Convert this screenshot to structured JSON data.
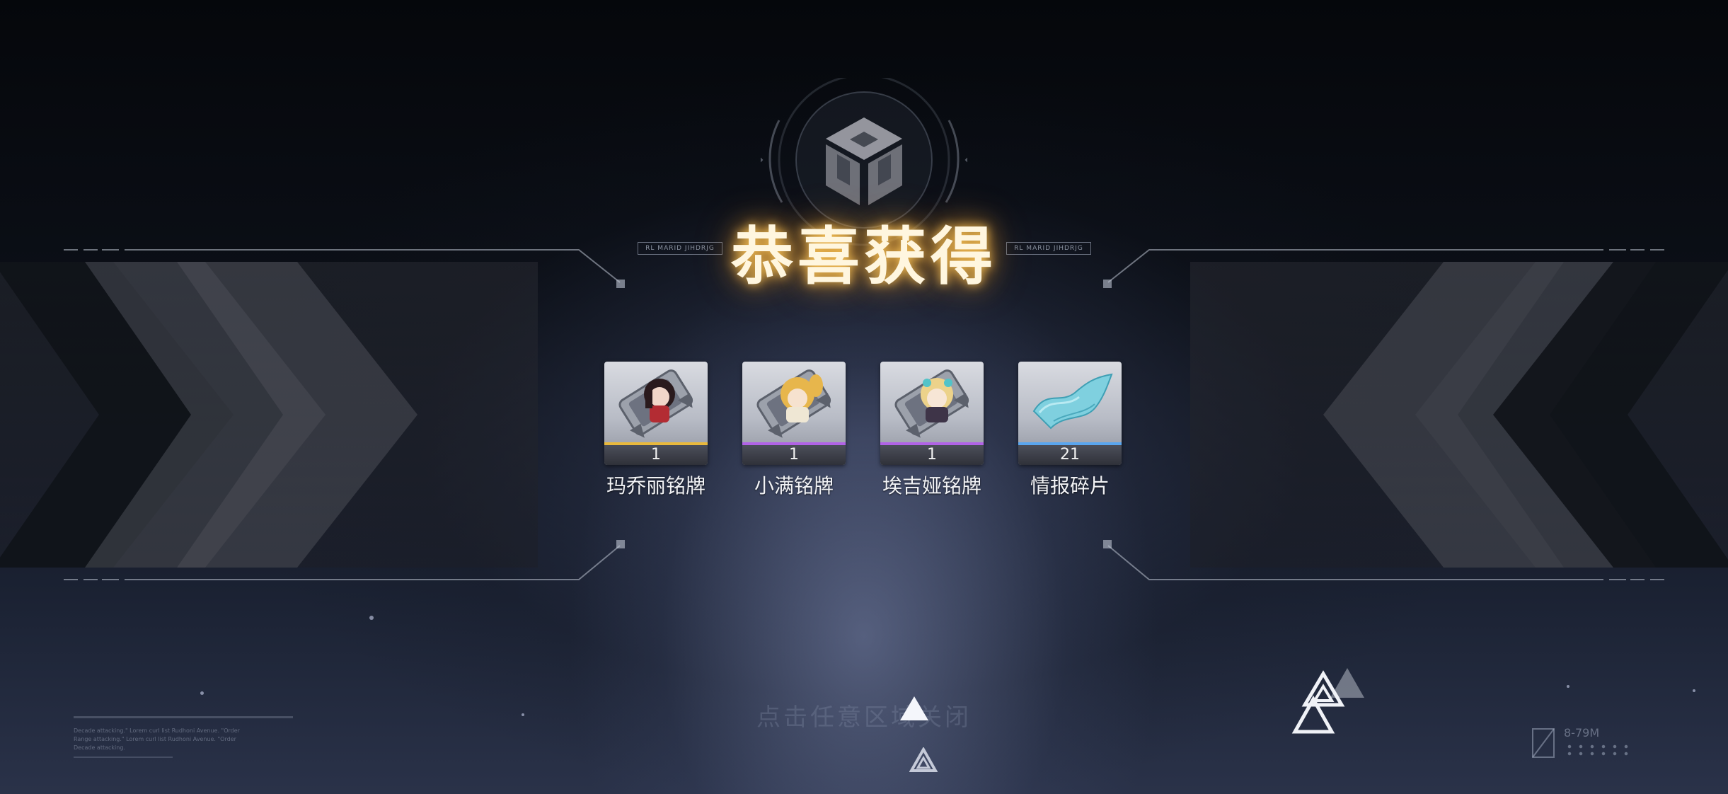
{
  "title": "恭喜获得",
  "tags": {
    "left": "RL MARID JIHDRJG",
    "right": "RL MARID JIHDRJG"
  },
  "rewards": [
    {
      "name": "玛乔丽铭牌",
      "count": "1",
      "rarity_color": "#e9b93c",
      "icon": "nameplate-marjorie-icon"
    },
    {
      "name": "小满铭牌",
      "count": "1",
      "rarity_color": "#b163e6",
      "icon": "nameplate-xiaoman-icon"
    },
    {
      "name": "埃吉娅铭牌",
      "count": "1",
      "rarity_color": "#b163e6",
      "icon": "nameplate-aegia-icon"
    },
    {
      "name": "情报碎片",
      "count": "21",
      "rarity_color": "#5aa6ef",
      "icon": "intel-fragment-icon"
    }
  ],
  "continue_hint": "点击任意区域关闭",
  "log_lines": [
    "Decade attacking.\" Lorem curl list Rudhoni Avenue. \"Order",
    "Range attacking.\" Lorem curl list Rudhoni Avenue. \"Order",
    "Decade attacking."
  ],
  "coords": "8-79M",
  "colors": {
    "title_glow": "#ffb43c",
    "accent": "#e9b93c"
  }
}
